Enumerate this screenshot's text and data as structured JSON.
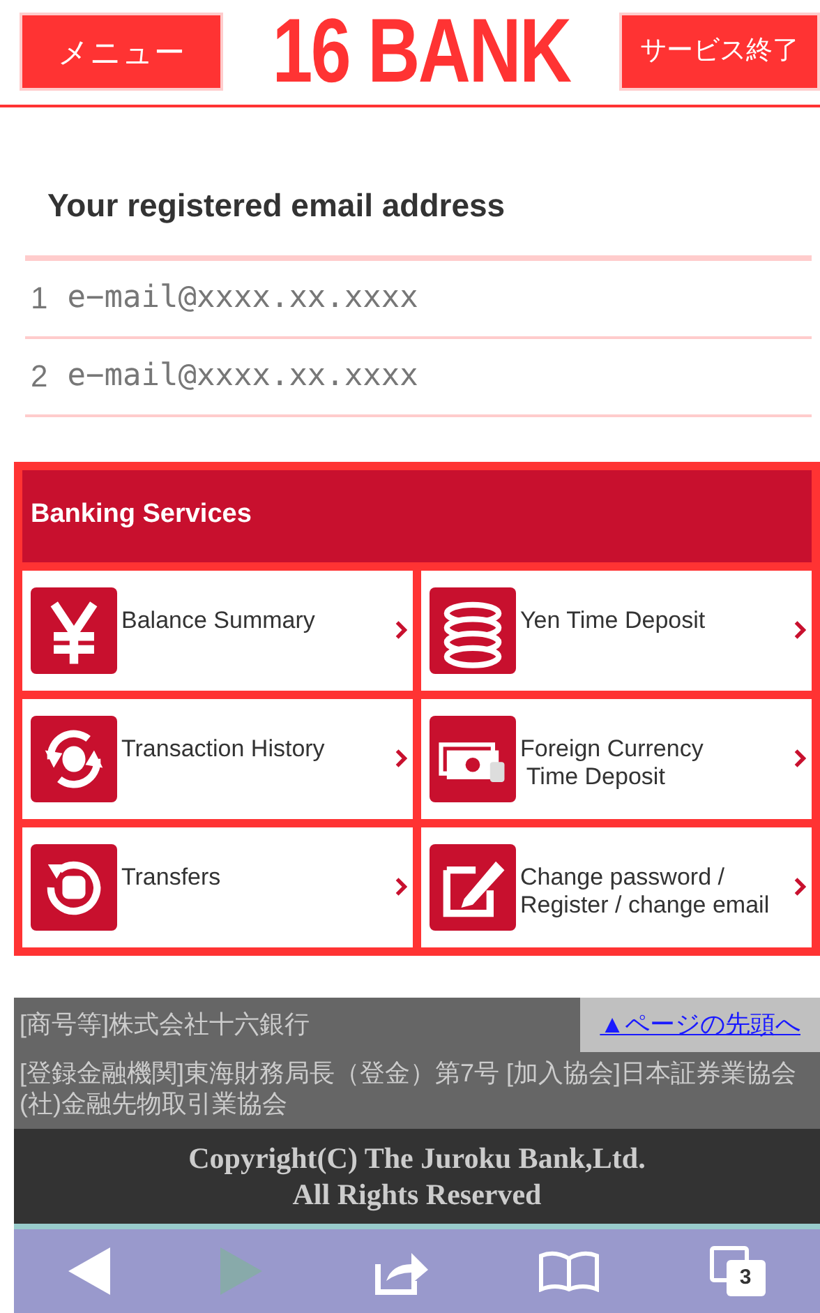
{
  "header": {
    "menu_button": "メニュー",
    "logo": "16 BANK",
    "exit_button": "サービス終了"
  },
  "email_section": {
    "title": "Your registered email address",
    "emails": [
      {
        "number": "1",
        "address": "e−mail@xxxx.xx.xxxx"
      },
      {
        "number": "2",
        "address": "e−mail@xxxx.xx.xxxx"
      }
    ]
  },
  "banking": {
    "title": "Banking Services",
    "items": [
      {
        "kind": "yen",
        "label": "Balance Summary"
      },
      {
        "kind": "coins",
        "label": "Yen Time Deposit"
      },
      {
        "kind": "history",
        "label": "Transaction History"
      },
      {
        "kind": "foreign",
        "label": "Foreign Currency\n Time Deposit"
      },
      {
        "kind": "transfer",
        "label": "Transfers"
      },
      {
        "kind": "edit",
        "label": "Change password /\nRegister / change email"
      }
    ]
  },
  "footer": {
    "company": "[商号等]株式会社十六銀行",
    "page_top_link": "▲ページの先頭へ",
    "registration": "[登録金融機関]東海財務局長（登金）第7号 [加入協会]日本証券業協会 (社)金融先物取引業協会",
    "copyright": "Copyright(C) The Juroku Bank,Ltd.\nAll Rights Reserved"
  },
  "toolbar": {
    "forward_disabled": true,
    "tab_count": "3"
  }
}
